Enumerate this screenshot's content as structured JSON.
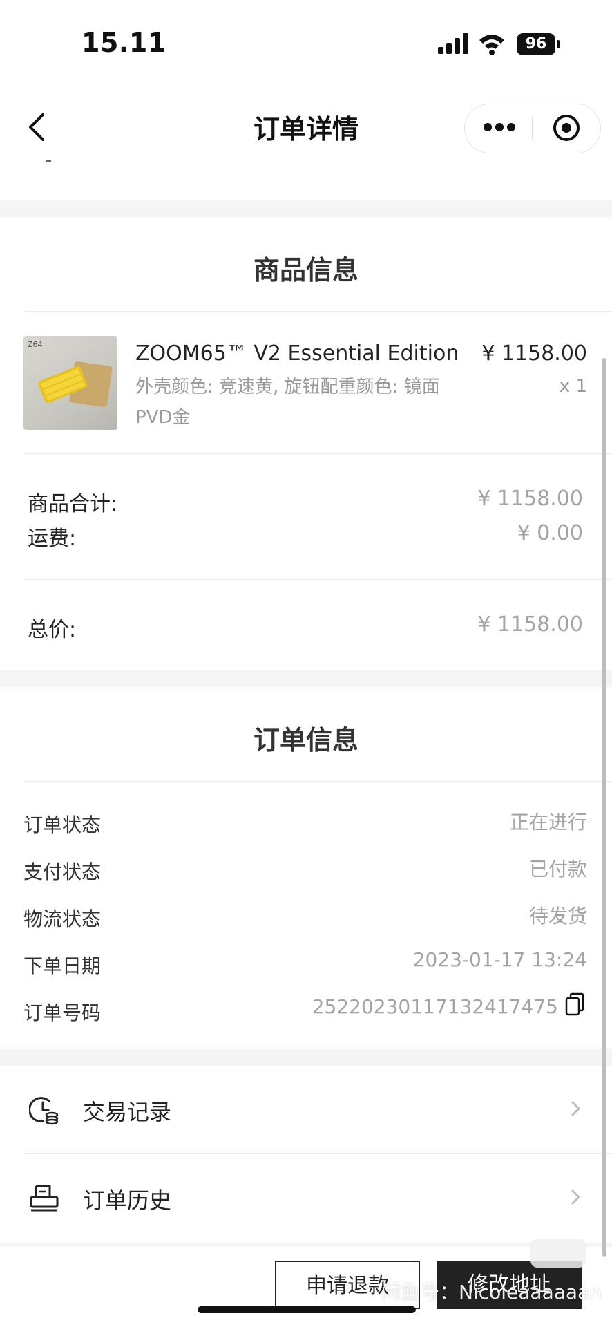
{
  "status_bar": {
    "time": "15.11",
    "battery": "96"
  },
  "nav": {
    "title": "订单详情"
  },
  "product_section": {
    "title": "商品信息",
    "item": {
      "name": "ZOOM65™ V2 Essential Edition",
      "price": "¥ 1158.00",
      "spec": "外壳颜色: 竞速黄, 旋钮配重颜色: 镜面PVD金",
      "qty": "x 1"
    },
    "subtotal_label": "商品合计:",
    "subtotal_value": "¥ 1158.00",
    "shipping_label": "运费:",
    "shipping_value": "¥ 0.00",
    "total_label": "总价:",
    "total_value": "¥ 1158.00"
  },
  "order_section": {
    "title": "订单信息",
    "rows": [
      {
        "label": "订单状态",
        "value": "正在进行"
      },
      {
        "label": "支付状态",
        "value": "已付款"
      },
      {
        "label": "物流状态",
        "value": "待发货"
      },
      {
        "label": "下单日期",
        "value": "2023-01-17 13:24"
      },
      {
        "label": "订单号码",
        "value": "2522023011713241747​5"
      }
    ]
  },
  "menu": [
    {
      "label": "交易记录",
      "icon": "clock-coin-icon"
    },
    {
      "label": "订单历史",
      "icon": "printer-icon"
    }
  ],
  "actions": {
    "refund": "申请退款",
    "address": "修改地址"
  },
  "watermark": "闲鱼号：Nicoleaaaaaan"
}
